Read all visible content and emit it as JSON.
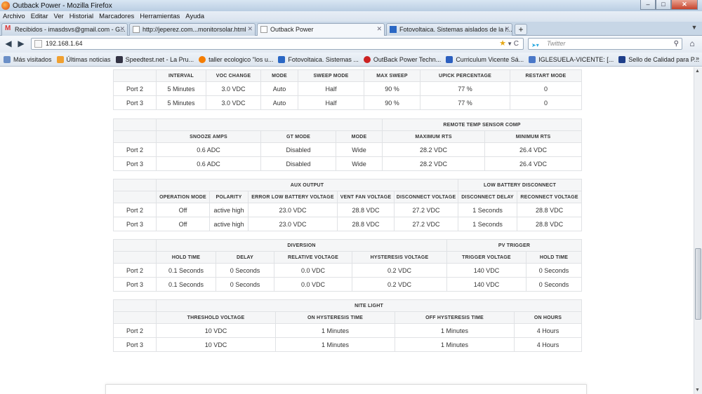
{
  "window": {
    "title": "Outback Power - Mozilla Firefox"
  },
  "menu": [
    "Archivo",
    "Editar",
    "Ver",
    "Historial",
    "Marcadores",
    "Herramientas",
    "Ayuda"
  ],
  "tabs": [
    {
      "label": "Recibidos - imasdsvs@gmail.com - G...",
      "icon": "gmail-icon"
    },
    {
      "label": "http://jeperez.com...monitorsolar.html",
      "icon": "page-icon"
    },
    {
      "label": "Outback Power",
      "icon": "page-icon"
    },
    {
      "label": "Fotovoltaica. Sistemas aislados de la r...",
      "icon": "blogger-icon"
    }
  ],
  "nav": {
    "url": "192.168.1.64",
    "search_placeholder": "Twitter"
  },
  "bookmarks": [
    "Más visitados",
    "Últimas noticias",
    "Speedtest.net - La Pru...",
    "taller ecologico \"los u...",
    "Fotovoltaica. Sistemas ...",
    "OutBack Power Techn...",
    "Curriculum Vicente Sá...",
    "IGLESUELA-VICENTE: [...",
    "Sello de Calidad para P..."
  ],
  "table1": {
    "headers": [
      "INTERVAL",
      "VOC CHANGE",
      "MODE",
      "SWEEP MODE",
      "MAX SWEEP",
      "UPICK PERCENTAGE",
      "RESTART MODE"
    ],
    "rows": [
      [
        "Port 2",
        "5 Minutes",
        "3.0 VDC",
        "Auto",
        "Half",
        "90 %",
        "77 %",
        "0"
      ],
      [
        "Port 3",
        "5 Minutes",
        "3.0 VDC",
        "Auto",
        "Half",
        "90 %",
        "77 %",
        "0"
      ]
    ]
  },
  "table2": {
    "group": "REMOTE TEMP SENSOR COMP",
    "headers": [
      "SNOOZE AMPS",
      "GT MODE",
      "MODE",
      "MAXIMUM RTS",
      "MINIMUM RTS"
    ],
    "rows": [
      [
        "Port 2",
        "0.6 ADC",
        "Disabled",
        "Wide",
        "28.2 VDC",
        "26.4 VDC"
      ],
      [
        "Port 3",
        "0.6 ADC",
        "Disabled",
        "Wide",
        "28.2 VDC",
        "26.4 VDC"
      ]
    ]
  },
  "table3": {
    "group1": "AUX OUTPUT",
    "group2": "LOW BATTERY DISCONNECT",
    "headers": [
      "OPERATION MODE",
      "POLARITY",
      "ERROR LOW BATTERY VOLTAGE",
      "VENT FAN VOLTAGE",
      "DISCONNECT VOLTAGE",
      "DISCONNECT DELAY",
      "RECONNECT VOLTAGE"
    ],
    "rows": [
      [
        "Port 2",
        "Off",
        "active high",
        "23.0 VDC",
        "28.8 VDC",
        "27.2 VDC",
        "1 Seconds",
        "28.8 VDC"
      ],
      [
        "Port 3",
        "Off",
        "active high",
        "23.0 VDC",
        "28.8 VDC",
        "27.2 VDC",
        "1 Seconds",
        "28.8 VDC"
      ]
    ]
  },
  "table4": {
    "group1": "DIVERSION",
    "group2": "PV TRIGGER",
    "headers": [
      "HOLD TIME",
      "DELAY",
      "RELATIVE VOLTAGE",
      "HYSTERESIS VOLTAGE",
      "TRIGGER VOLTAGE",
      "HOLD TIME"
    ],
    "rows": [
      [
        "Port 2",
        "0.1 Seconds",
        "0 Seconds",
        "0.0 VDC",
        "0.2 VDC",
        "140 VDC",
        "0 Seconds"
      ],
      [
        "Port 3",
        "0.1 Seconds",
        "0 Seconds",
        "0.0 VDC",
        "0.2 VDC",
        "140 VDC",
        "0 Seconds"
      ]
    ]
  },
  "table5": {
    "group": "NITE LIGHT",
    "headers": [
      "THRESHOLD VOLTAGE",
      "ON HYSTERESIS TIME",
      "OFF HYSTERESIS TIME",
      "ON HOURS"
    ],
    "rows": [
      [
        "Port 2",
        "10 VDC",
        "1 Minutes",
        "1 Minutes",
        "4 Hours"
      ],
      [
        "Port 3",
        "10 VDC",
        "1 Minutes",
        "1 Minutes",
        "4 Hours"
      ]
    ]
  }
}
